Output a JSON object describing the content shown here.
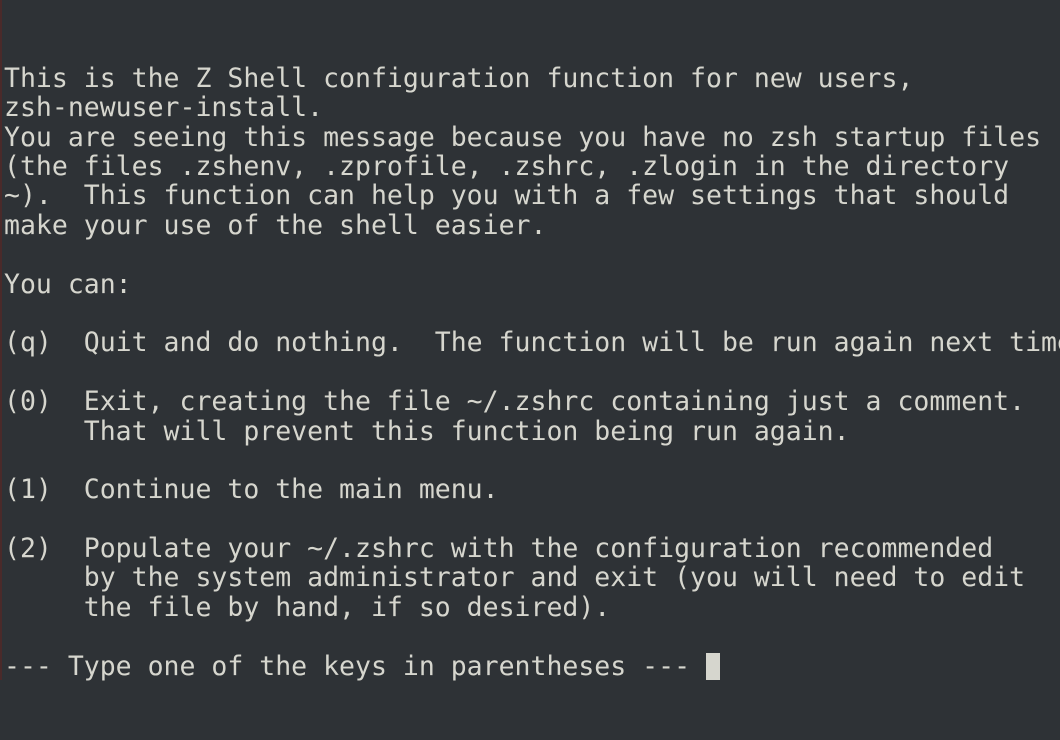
{
  "terminal": {
    "lines": [
      "This is the Z Shell configuration function for new users,",
      "zsh-newuser-install.",
      "You are seeing this message because you have no zsh startup files",
      "(the files .zshenv, .zprofile, .zshrc, .zlogin in the directory",
      "~).  This function can help you with a few settings that should",
      "make your use of the shell easier.",
      "",
      "You can:",
      "",
      "(q)  Quit and do nothing.  The function will be run again next time.",
      "",
      "(0)  Exit, creating the file ~/.zshrc containing just a comment.",
      "     That will prevent this function being run again.",
      "",
      "(1)  Continue to the main menu.",
      "",
      "(2)  Populate your ~/.zshrc with the configuration recommended",
      "     by the system administrator and exit (you will need to edit",
      "     the file by hand, if so desired).",
      ""
    ],
    "prompt": "--- Type one of the keys in parentheses --- "
  }
}
